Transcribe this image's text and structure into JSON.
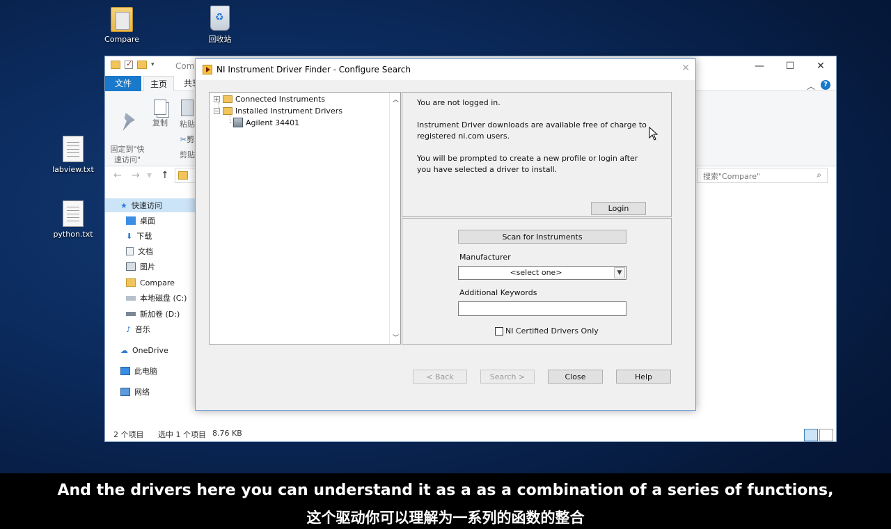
{
  "desktop": {
    "icons": [
      {
        "label": "Compare"
      },
      {
        "label": "回收站"
      },
      {
        "label": "labview.txt"
      },
      {
        "label": "python.txt"
      }
    ]
  },
  "explorer": {
    "title_partial": "Compa",
    "tabs": {
      "file": "文件",
      "home": "主页",
      "share": "共享"
    },
    "ribbon": {
      "pin": "固定到\"快\n速访问\"",
      "copy": "复制",
      "paste": "粘贴",
      "cut_partial": "剪",
      "clipboard_partial": "剪贴"
    },
    "search_placeholder": "搜索\"Compare\"",
    "nav_items": [
      "快速访问",
      "桌面",
      "下载",
      "文档",
      "图片",
      "Compare",
      "本地磁盘 (C:)",
      "新加卷 (D:)",
      "音乐",
      "OneDrive",
      "此电脑",
      "网络"
    ],
    "status": {
      "count": "2 个项目",
      "selected": "选中 1 个项目",
      "size": "8.76 KB"
    }
  },
  "dialog": {
    "title": "NI Instrument Driver Finder - Configure Search",
    "tree": {
      "connected": "Connected Instruments",
      "installed": "Installed Instrument Drivers",
      "child": "Agilent 34401"
    },
    "login_panel": {
      "line1": "You are not logged in.",
      "line2a": "Instrument Driver downloads are available free of charge to",
      "line2b": "registered ni.com users.",
      "line3a": "You will be prompted to create a new profile or login after",
      "line3b": "you have selected a driver to install.",
      "login_button": "Login"
    },
    "search_panel": {
      "scan_button": "Scan for Instruments",
      "manufacturer_label": "Manufacturer",
      "manufacturer_value": "<select one>",
      "keywords_label": "Additional Keywords",
      "keywords_value": "",
      "certified_label": "NI Certified Drivers Only"
    },
    "buttons": {
      "back": "< Back",
      "search": "Search >",
      "close": "Close",
      "help": "Help"
    }
  },
  "subtitles": {
    "en": "And the drivers here you can understand it as a as a combination of a series of functions,",
    "zh": "这个驱动你可以理解为一系列的函数的整合"
  }
}
